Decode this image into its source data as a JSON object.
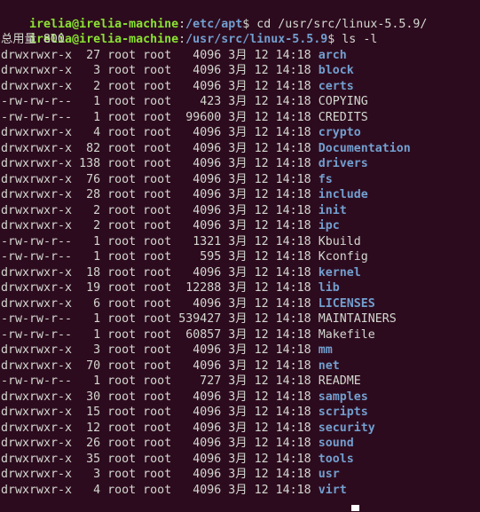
{
  "terminal": {
    "background_color": "#2d0b1e",
    "foreground_color": "#d3d7cf",
    "prompt_user_color": "#8ae234",
    "prompt_path_color": "#729fcf",
    "directory_color": "#729fcf",
    "cursor_color": "#ffffff"
  },
  "prompts": [
    {
      "user_host": "irelia@irelia-machine",
      "separator": ":",
      "path": "/etc/apt",
      "sigil": "$ ",
      "command": "cd /usr/src/linux-5.5.9/"
    },
    {
      "user_host": "irelia@irelia-machine",
      "separator": ":",
      "path": "/usr/src/linux-5.5.9",
      "sigil": "$ ",
      "command": "ls -l"
    }
  ],
  "total_line": "总用量 800",
  "listing": [
    {
      "perm": "drwxrwxr-x",
      "links": "27",
      "owner": "root",
      "group": "root",
      "size": "4096",
      "month": "3月",
      "day": "12",
      "time": "14:18",
      "name": "arch",
      "type": "dir"
    },
    {
      "perm": "drwxrwxr-x",
      "links": "3",
      "owner": "root",
      "group": "root",
      "size": "4096",
      "month": "3月",
      "day": "12",
      "time": "14:18",
      "name": "block",
      "type": "dir"
    },
    {
      "perm": "drwxrwxr-x",
      "links": "2",
      "owner": "root",
      "group": "root",
      "size": "4096",
      "month": "3月",
      "day": "12",
      "time": "14:18",
      "name": "certs",
      "type": "dir"
    },
    {
      "perm": "-rw-rw-r--",
      "links": "1",
      "owner": "root",
      "group": "root",
      "size": "423",
      "month": "3月",
      "day": "12",
      "time": "14:18",
      "name": "COPYING",
      "type": "file"
    },
    {
      "perm": "-rw-rw-r--",
      "links": "1",
      "owner": "root",
      "group": "root",
      "size": "99600",
      "month": "3月",
      "day": "12",
      "time": "14:18",
      "name": "CREDITS",
      "type": "file"
    },
    {
      "perm": "drwxrwxr-x",
      "links": "4",
      "owner": "root",
      "group": "root",
      "size": "4096",
      "month": "3月",
      "day": "12",
      "time": "14:18",
      "name": "crypto",
      "type": "dir"
    },
    {
      "perm": "drwxrwxr-x",
      "links": "82",
      "owner": "root",
      "group": "root",
      "size": "4096",
      "month": "3月",
      "day": "12",
      "time": "14:18",
      "name": "Documentation",
      "type": "dir"
    },
    {
      "perm": "drwxrwxr-x",
      "links": "138",
      "owner": "root",
      "group": "root",
      "size": "4096",
      "month": "3月",
      "day": "12",
      "time": "14:18",
      "name": "drivers",
      "type": "dir"
    },
    {
      "perm": "drwxrwxr-x",
      "links": "76",
      "owner": "root",
      "group": "root",
      "size": "4096",
      "month": "3月",
      "day": "12",
      "time": "14:18",
      "name": "fs",
      "type": "dir"
    },
    {
      "perm": "drwxrwxr-x",
      "links": "28",
      "owner": "root",
      "group": "root",
      "size": "4096",
      "month": "3月",
      "day": "12",
      "time": "14:18",
      "name": "include",
      "type": "dir"
    },
    {
      "perm": "drwxrwxr-x",
      "links": "2",
      "owner": "root",
      "group": "root",
      "size": "4096",
      "month": "3月",
      "day": "12",
      "time": "14:18",
      "name": "init",
      "type": "dir"
    },
    {
      "perm": "drwxrwxr-x",
      "links": "2",
      "owner": "root",
      "group": "root",
      "size": "4096",
      "month": "3月",
      "day": "12",
      "time": "14:18",
      "name": "ipc",
      "type": "dir"
    },
    {
      "perm": "-rw-rw-r--",
      "links": "1",
      "owner": "root",
      "group": "root",
      "size": "1321",
      "month": "3月",
      "day": "12",
      "time": "14:18",
      "name": "Kbuild",
      "type": "file"
    },
    {
      "perm": "-rw-rw-r--",
      "links": "1",
      "owner": "root",
      "group": "root",
      "size": "595",
      "month": "3月",
      "day": "12",
      "time": "14:18",
      "name": "Kconfig",
      "type": "file"
    },
    {
      "perm": "drwxrwxr-x",
      "links": "18",
      "owner": "root",
      "group": "root",
      "size": "4096",
      "month": "3月",
      "day": "12",
      "time": "14:18",
      "name": "kernel",
      "type": "dir"
    },
    {
      "perm": "drwxrwxr-x",
      "links": "19",
      "owner": "root",
      "group": "root",
      "size": "12288",
      "month": "3月",
      "day": "12",
      "time": "14:18",
      "name": "lib",
      "type": "dir"
    },
    {
      "perm": "drwxrwxr-x",
      "links": "6",
      "owner": "root",
      "group": "root",
      "size": "4096",
      "month": "3月",
      "day": "12",
      "time": "14:18",
      "name": "LICENSES",
      "type": "dir"
    },
    {
      "perm": "-rw-rw-r--",
      "links": "1",
      "owner": "root",
      "group": "root",
      "size": "539427",
      "month": "3月",
      "day": "12",
      "time": "14:18",
      "name": "MAINTAINERS",
      "type": "file"
    },
    {
      "perm": "-rw-rw-r--",
      "links": "1",
      "owner": "root",
      "group": "root",
      "size": "60857",
      "month": "3月",
      "day": "12",
      "time": "14:18",
      "name": "Makefile",
      "type": "file"
    },
    {
      "perm": "drwxrwxr-x",
      "links": "3",
      "owner": "root",
      "group": "root",
      "size": "4096",
      "month": "3月",
      "day": "12",
      "time": "14:18",
      "name": "mm",
      "type": "dir"
    },
    {
      "perm": "drwxrwxr-x",
      "links": "70",
      "owner": "root",
      "group": "root",
      "size": "4096",
      "month": "3月",
      "day": "12",
      "time": "14:18",
      "name": "net",
      "type": "dir"
    },
    {
      "perm": "-rw-rw-r--",
      "links": "1",
      "owner": "root",
      "group": "root",
      "size": "727",
      "month": "3月",
      "day": "12",
      "time": "14:18",
      "name": "README",
      "type": "file"
    },
    {
      "perm": "drwxrwxr-x",
      "links": "30",
      "owner": "root",
      "group": "root",
      "size": "4096",
      "month": "3月",
      "day": "12",
      "time": "14:18",
      "name": "samples",
      "type": "dir"
    },
    {
      "perm": "drwxrwxr-x",
      "links": "15",
      "owner": "root",
      "group": "root",
      "size": "4096",
      "month": "3月",
      "day": "12",
      "time": "14:18",
      "name": "scripts",
      "type": "dir"
    },
    {
      "perm": "drwxrwxr-x",
      "links": "12",
      "owner": "root",
      "group": "root",
      "size": "4096",
      "month": "3月",
      "day": "12",
      "time": "14:18",
      "name": "security",
      "type": "dir"
    },
    {
      "perm": "drwxrwxr-x",
      "links": "26",
      "owner": "root",
      "group": "root",
      "size": "4096",
      "month": "3月",
      "day": "12",
      "time": "14:18",
      "name": "sound",
      "type": "dir"
    },
    {
      "perm": "drwxrwxr-x",
      "links": "35",
      "owner": "root",
      "group": "root",
      "size": "4096",
      "month": "3月",
      "day": "12",
      "time": "14:18",
      "name": "tools",
      "type": "dir"
    },
    {
      "perm": "drwxrwxr-x",
      "links": "3",
      "owner": "root",
      "group": "root",
      "size": "4096",
      "month": "3月",
      "day": "12",
      "time": "14:18",
      "name": "usr",
      "type": "dir"
    },
    {
      "perm": "drwxrwxr-x",
      "links": "4",
      "owner": "root",
      "group": "root",
      "size": "4096",
      "month": "3月",
      "day": "12",
      "time": "14:18",
      "name": "virt",
      "type": "dir"
    }
  ]
}
